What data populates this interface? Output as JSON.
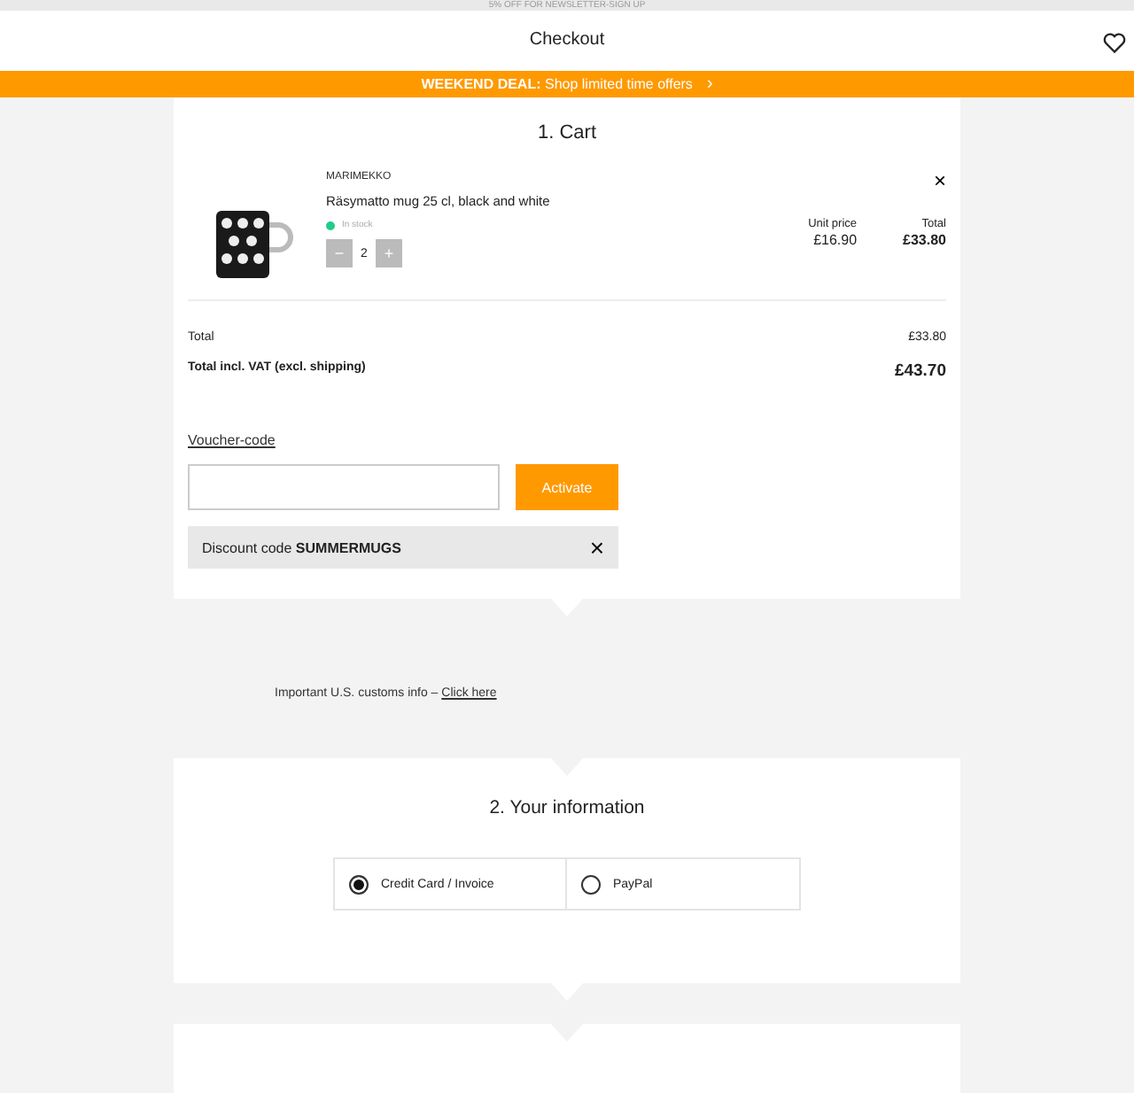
{
  "top_banner": "5% OFF FOR NEWSLETTER-SIGN UP",
  "header": {
    "title": "Checkout"
  },
  "promo_bar": {
    "label": "WEEKEND DEAL:",
    "text": "Shop limited time offers",
    "arrow": "›"
  },
  "cart": {
    "title": "1. Cart",
    "items": [
      {
        "brand": "MARIMEKKO",
        "name": "Räsymatto mug 25 cl, black and white",
        "stock": "In stock",
        "minus": "−",
        "quantity": "2",
        "plus": "+",
        "unit_price_label": "Unit price",
        "unit_price": "£16.90",
        "total_label": "Total",
        "total": "£33.80",
        "remove": "×"
      }
    ],
    "summary": [
      {
        "label": "Total",
        "value": "£33.80",
        "bold": false
      },
      {
        "label": "Total incl. VAT (excl. shipping)",
        "value": "£43.70",
        "bold": true
      }
    ],
    "voucher": {
      "link": "Voucher-code",
      "button": "Activate",
      "discount_text": "Discount code **SUMMERMUGS**",
      "remove": "×"
    }
  },
  "customs": {
    "text": "Important U.S. customs info –",
    "link": "Click here"
  },
  "information": {
    "title": "2. Your information",
    "payment_options": [
      {
        "label": "Credit Card / Invoice",
        "selected": true
      },
      {
        "label": "PayPal",
        "selected": false
      }
    ]
  }
}
